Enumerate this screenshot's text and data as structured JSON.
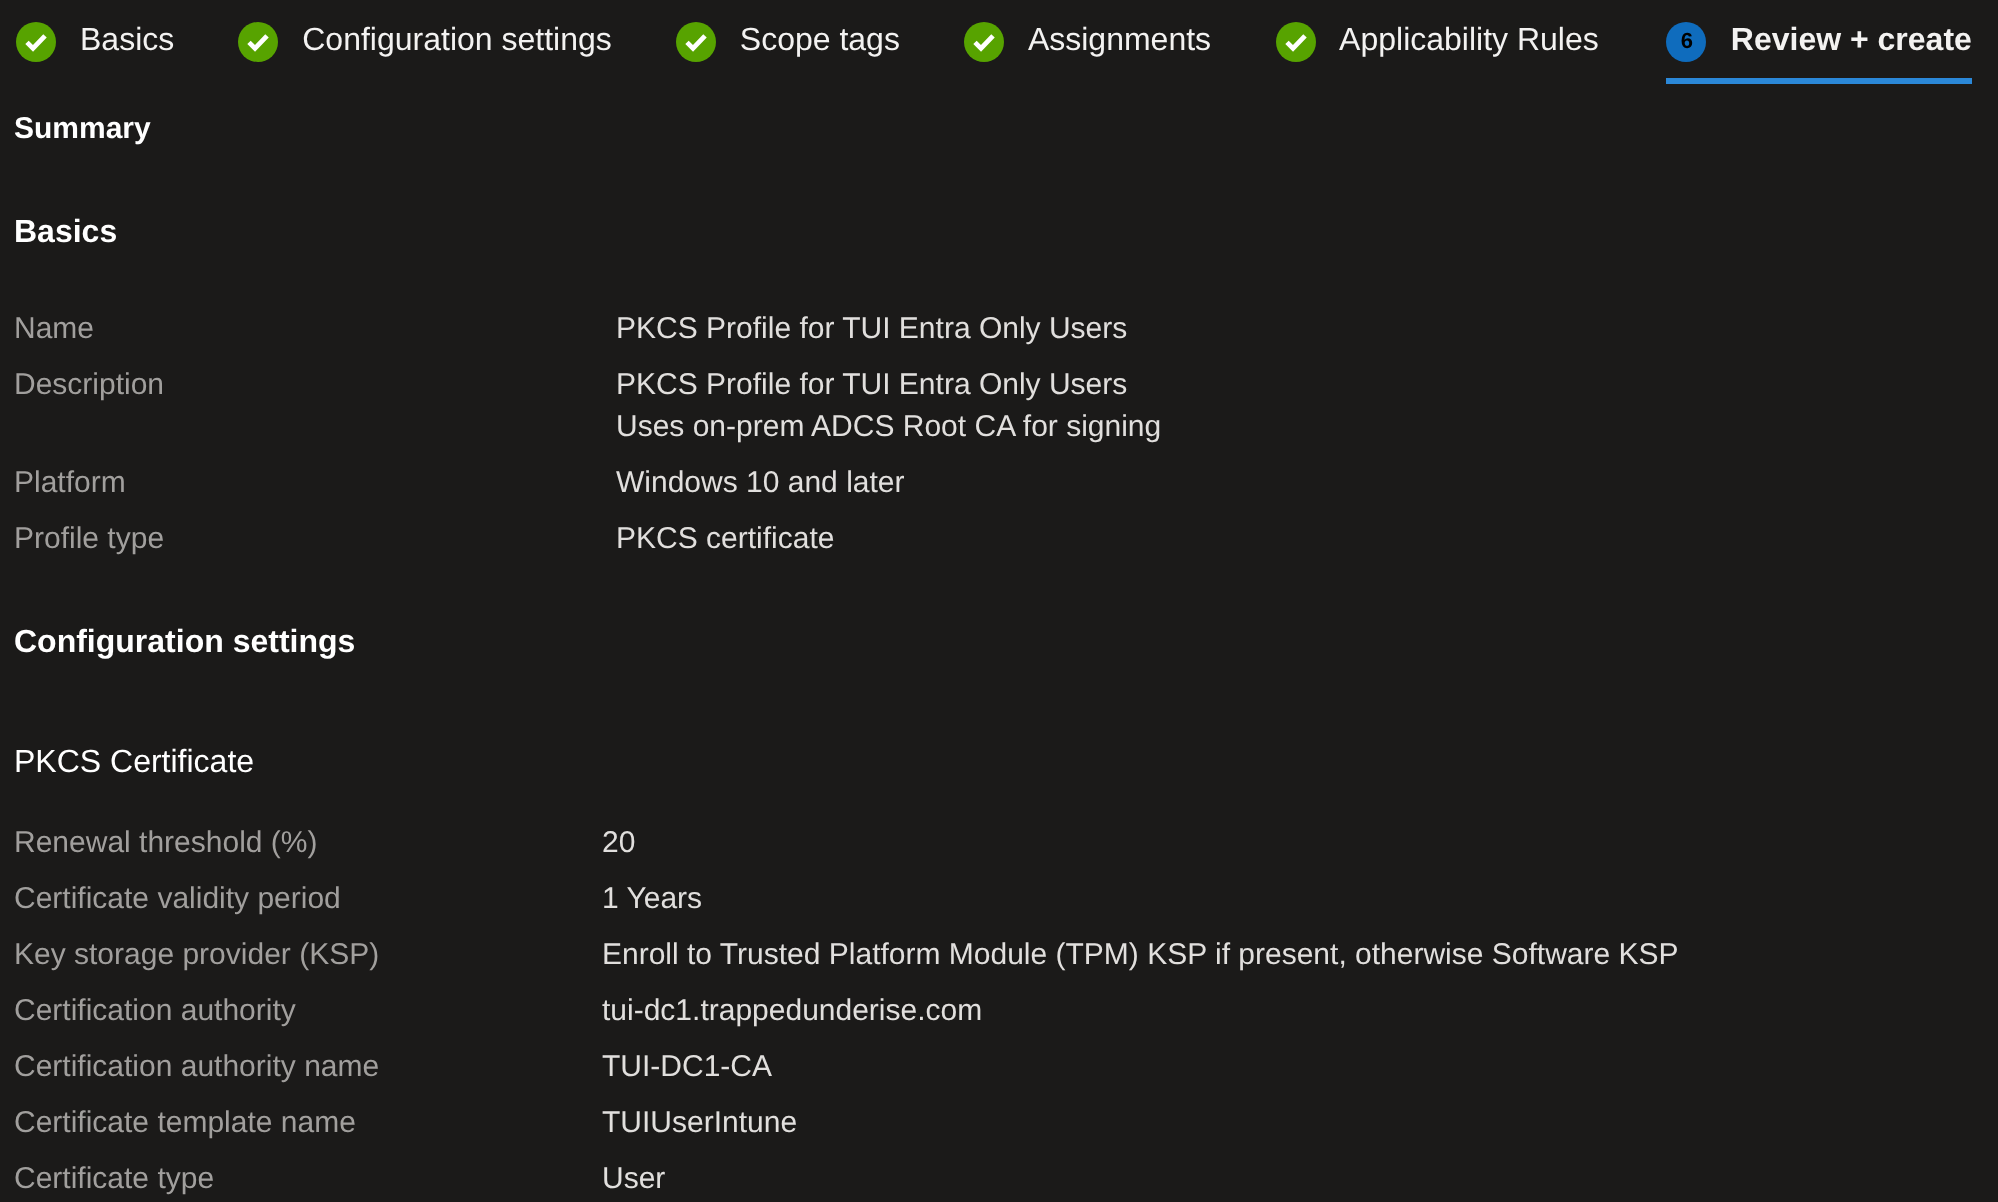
{
  "steps": [
    {
      "label": "Basics",
      "completed": true,
      "selected": false
    },
    {
      "label": "Configuration settings",
      "completed": true,
      "selected": false
    },
    {
      "label": "Scope tags",
      "completed": true,
      "selected": false
    },
    {
      "label": "Assignments",
      "completed": true,
      "selected": false
    },
    {
      "label": "Applicability Rules",
      "completed": true,
      "selected": false
    },
    {
      "label": "Review + create",
      "completed": false,
      "number": "6",
      "selected": true
    }
  ],
  "summary_title": "Summary",
  "sections": [
    {
      "kind": "section",
      "title": "Basics",
      "rows": [
        {
          "label": "Name",
          "value": [
            "PKCS Profile for TUI Entra Only Users"
          ]
        },
        {
          "label": "Description",
          "value": [
            "PKCS Profile for TUI Entra Only Users",
            "Uses on-prem ADCS Root CA for signing"
          ]
        },
        {
          "label": "Platform",
          "value": [
            "Windows 10 and later"
          ]
        },
        {
          "label": "Profile type",
          "value": [
            "PKCS certificate"
          ]
        }
      ]
    },
    {
      "kind": "section",
      "title": "Configuration settings"
    },
    {
      "kind": "group",
      "title": "PKCS Certificate",
      "rows": [
        {
          "label": "Renewal threshold (%)",
          "value": [
            "20"
          ]
        },
        {
          "label": "Certificate validity period",
          "value": [
            "1 Years"
          ]
        },
        {
          "label": "Key storage provider (KSP)",
          "value": [
            "Enroll to Trusted Platform Module (TPM) KSP if present, otherwise Software KSP"
          ]
        },
        {
          "label": "Certification authority",
          "value": [
            "tui-dc1.trappedunderise.com"
          ]
        },
        {
          "label": "Certification authority name",
          "value": [
            "TUI-DC1-CA"
          ]
        },
        {
          "label": "Certificate template name",
          "value": [
            "TUIUserIntune"
          ]
        },
        {
          "label": "Certificate type",
          "value": [
            "User"
          ]
        }
      ]
    }
  ]
}
